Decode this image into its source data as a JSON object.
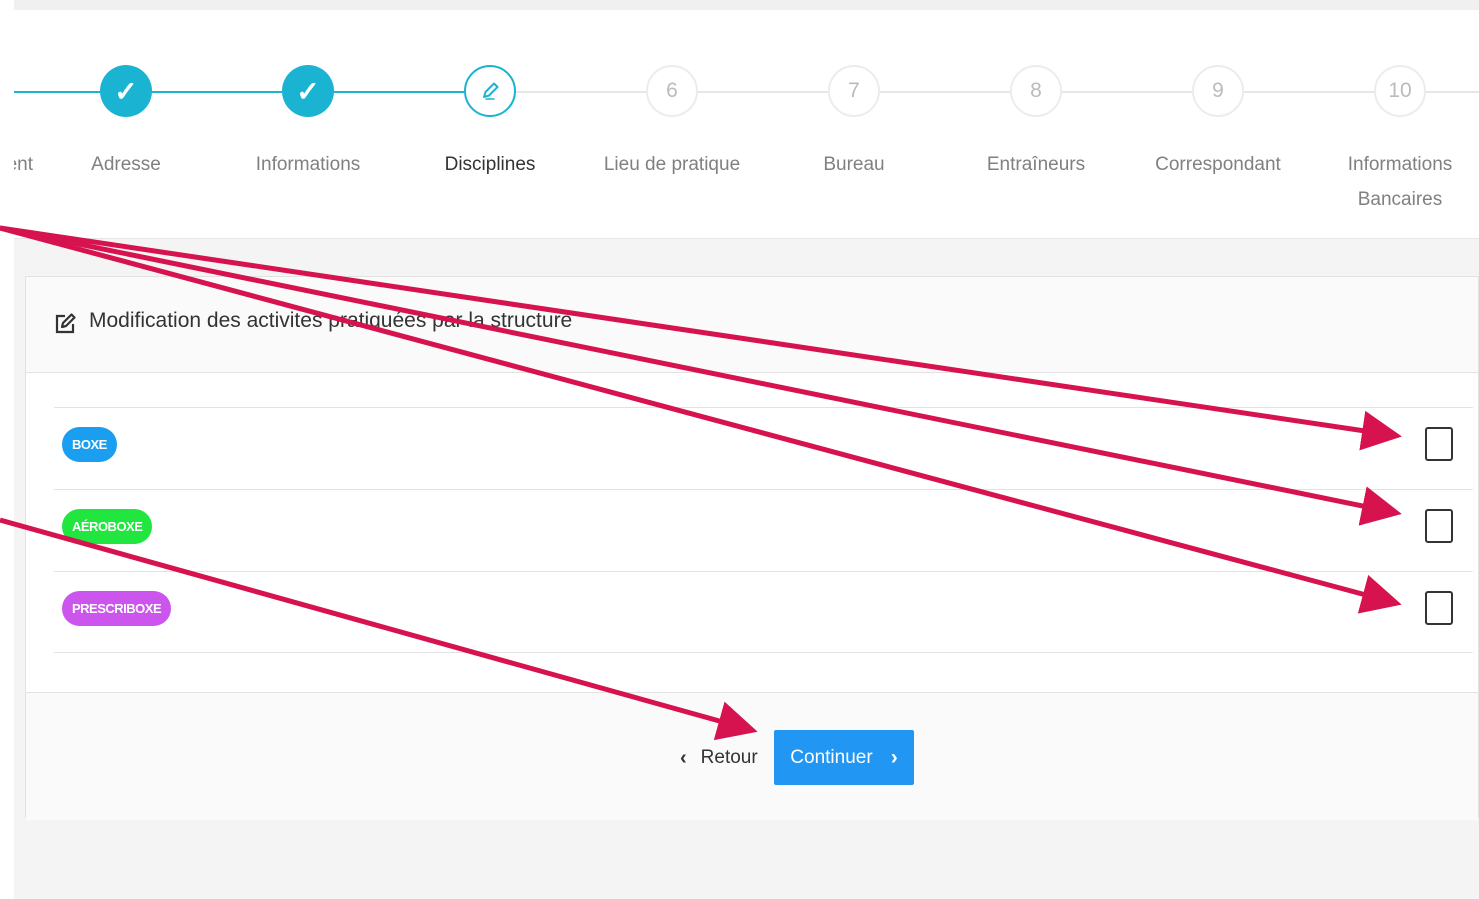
{
  "stepper": {
    "steps": [
      {
        "label": "ent",
        "state": "done",
        "number": ""
      },
      {
        "label": "Adresse",
        "state": "done",
        "number": "✓"
      },
      {
        "label": "Informations",
        "state": "done",
        "number": "✓"
      },
      {
        "label": "Disciplines",
        "state": "current",
        "number": "✎"
      },
      {
        "label": "Lieu de pratique",
        "state": "todo",
        "number": "6"
      },
      {
        "label": "Bureau",
        "state": "todo",
        "number": "7"
      },
      {
        "label": "Entraîneurs",
        "state": "todo",
        "number": "8"
      },
      {
        "label": "Correspondant",
        "state": "todo",
        "number": "9"
      },
      {
        "label": "Informations Bancaires",
        "state": "todo",
        "number": "10"
      }
    ],
    "done_color": "#1ab4d2",
    "todo_color": "#e7e7e7"
  },
  "card": {
    "title": "Modification des activites pratiquées par la structure",
    "disciplines": [
      {
        "label": "BOXE",
        "color": "#1a9ef0",
        "checked": false
      },
      {
        "label": "AÉROBOXE",
        "color": "#20e63f",
        "checked": false
      },
      {
        "label": "PRESCRIBOXE",
        "color": "#cc55ee",
        "checked": false
      }
    ]
  },
  "footer": {
    "back_label": "Retour",
    "continue_label": "Continuer",
    "continue_color": "#2196f3"
  },
  "annotation": {
    "arrow_color": "#d6124f"
  }
}
